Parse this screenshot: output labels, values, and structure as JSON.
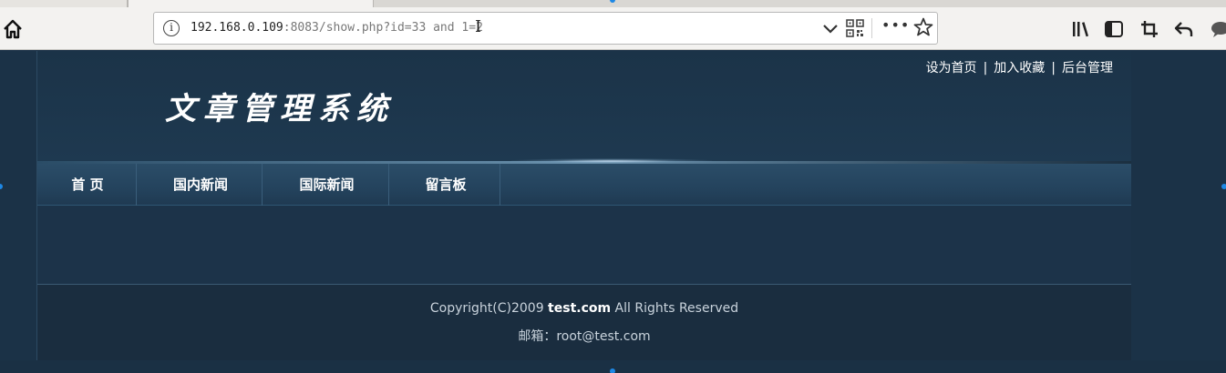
{
  "browser": {
    "url_host": "192.168.0.109",
    "url_rest": ":8083/show.php?id=33 and 1=2",
    "icons": {
      "home": "home-icon",
      "info": "info-icon",
      "dropdown": "chevron-down-icon",
      "qr": "qr-code-icon",
      "more": "more-icon",
      "bookmark": "star-icon",
      "library": "library-icon",
      "sidebar": "sidebar-icon",
      "screenshot": "crop-icon",
      "back": "undo-icon",
      "chat": "chat-icon"
    },
    "info_glyph": "i",
    "cursor_glyph": "I",
    "more_glyph": "•••"
  },
  "site": {
    "title": "文章管理系统",
    "top_links": [
      "设为首页",
      "加入收藏",
      "后台管理"
    ],
    "link_separator": "|",
    "menu": [
      "首 页",
      "国内新闻",
      "国际新闻",
      "留言板"
    ],
    "footer": {
      "copyright_prefix": "Copyright(C)2009 ",
      "copyright_site": "test.com",
      "copyright_suffix": " All Rights Reserved",
      "email_line": "邮箱：root@test.com"
    }
  },
  "colors": {
    "page_bg": "#1b3247",
    "menu_bg": "#24435d",
    "footer_bg": "#1a2d3f",
    "text": "#ffffff",
    "accent_handle": "#1e88e5"
  }
}
